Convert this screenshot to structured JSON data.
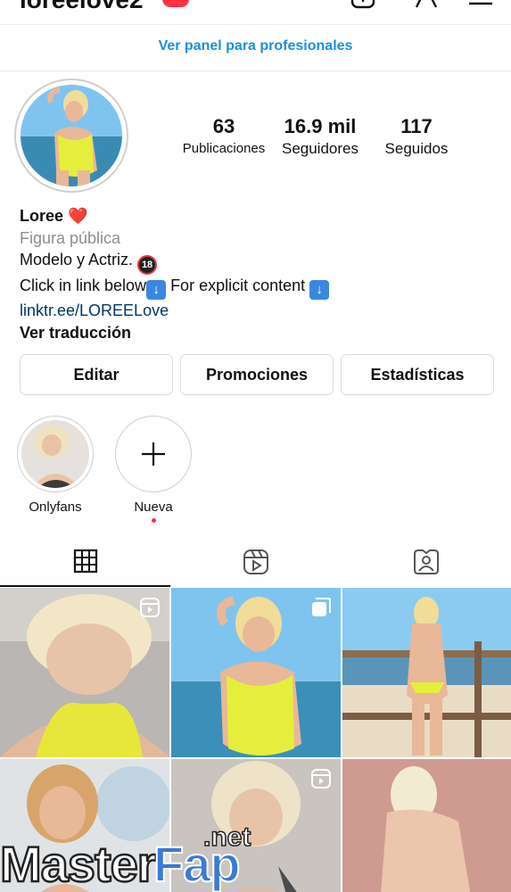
{
  "header": {
    "username": "loreelove2",
    "icons": [
      "create-icon",
      "account-icon",
      "menu-icon"
    ]
  },
  "pro_panel": {
    "label": "Ver panel para profesionales"
  },
  "profile": {
    "stats": [
      {
        "value": "63",
        "label": "Publicaciones"
      },
      {
        "value": "16.9 mil",
        "label": "Seguidores"
      },
      {
        "value": "117",
        "label": "Seguidos"
      }
    ],
    "name": "Loree",
    "name_emoji": "❤️",
    "category": "Figura pública",
    "bio_line1": "Modelo y Actriz.",
    "bio_line1_emoji": "18",
    "bio_line2a": "Click in link below",
    "bio_line2b": " For explicit content ",
    "link": "linktr.ee/LOREELove",
    "translate": "Ver traducción"
  },
  "buttons": {
    "edit": "Editar",
    "promotions": "Promociones",
    "stats": "Estadísticas"
  },
  "highlights": [
    {
      "label": "Onlyfans"
    },
    {
      "label": "Nueva"
    }
  ],
  "tabs": [
    "grid-icon",
    "reels-icon",
    "tagged-icon"
  ],
  "grid_icons": [
    "reel-icon",
    "carousel-icon",
    "reel-icon"
  ],
  "colors": {
    "accent": "#1a8fe0",
    "link": "#00376b",
    "notification": "#ff3040"
  },
  "watermark": {
    "main": "MasterFap",
    "suffix": ".net"
  }
}
